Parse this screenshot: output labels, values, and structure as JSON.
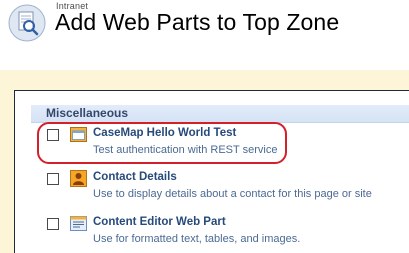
{
  "header": {
    "site_name": "Intranet",
    "page_title": "Add Web Parts to Top Zone"
  },
  "section": {
    "title": "Miscellaneous"
  },
  "web_parts": [
    {
      "title": "CaseMap Hello World Test",
      "description": "Test authentication with REST service",
      "icon": "web-part-window-icon",
      "checked": false
    },
    {
      "title": "Contact Details",
      "description": "Use to display details about a contact for this page or site",
      "icon": "contact-person-icon",
      "checked": false
    },
    {
      "title": "Content Editor Web Part",
      "description": "Use for formatted text, tables, and images.",
      "icon": "content-editor-icon",
      "checked": false
    }
  ],
  "colors": {
    "body_band": "#fdf5d8",
    "section_header": "#dde8f8",
    "highlight": "#d3202a",
    "title_text": "#274a7a"
  }
}
